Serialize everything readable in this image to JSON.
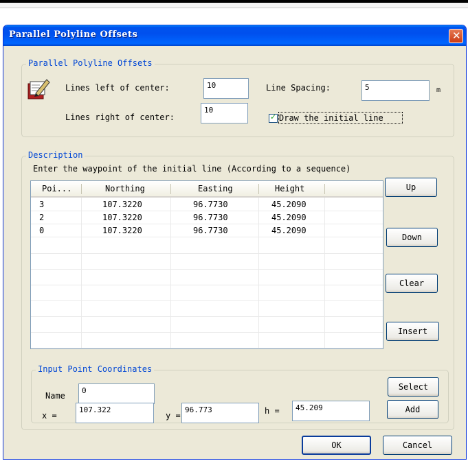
{
  "window": {
    "title": "Parallel Polyline Offsets"
  },
  "offsets_group": {
    "legend": "Parallel Polyline Offsets",
    "lines_left_label": "Lines left of center:",
    "lines_left_value": "10",
    "lines_right_label": "Lines right of center:",
    "lines_right_value": "10",
    "spacing_label": "Line Spacing:",
    "spacing_value": "5",
    "spacing_unit": "m",
    "draw_initial_label": "Draw the initial line",
    "draw_initial_checked": true
  },
  "description_group": {
    "legend": "Description",
    "instruction": "Enter the waypoint of the initial line (According to a sequence)",
    "columns": [
      "Poi...",
      "Northing",
      "Easting",
      "Height"
    ],
    "rows": [
      [
        "3",
        "107.3220",
        "96.7730",
        "45.2090"
      ],
      [
        "2",
        "107.3220",
        "96.7730",
        "45.2090"
      ],
      [
        "0",
        "107.3220",
        "96.7730",
        "45.2090"
      ]
    ],
    "buttons": {
      "up": "Up",
      "down": "Down",
      "clear": "Clear",
      "insert": "Insert"
    }
  },
  "input_group": {
    "legend": "Input Point Coordinates",
    "name_label": "Name",
    "name_value": "0",
    "x_label": "x =",
    "x_value": "107.322",
    "y_label": "y =",
    "y_value": "96.773",
    "h_label": "h =",
    "h_value": "45.209",
    "select_label": "Select",
    "add_label": "Add"
  },
  "footer": {
    "ok_label": "OK",
    "cancel_label": "Cancel"
  }
}
